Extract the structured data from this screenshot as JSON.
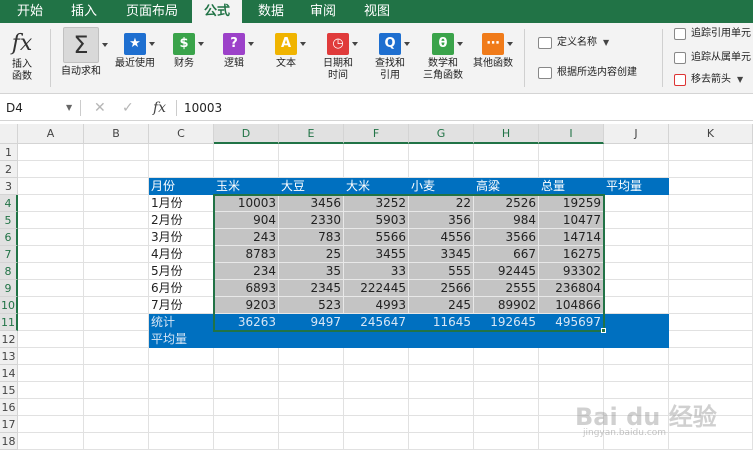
{
  "tabs": [
    "开始",
    "插入",
    "页面布局",
    "公式",
    "数据",
    "审阅",
    "视图"
  ],
  "ribbon": {
    "insert_function": {
      "line1": "插入",
      "line2": "函数"
    },
    "autosum": "自动求和",
    "recent": "最近使用",
    "financial": "财务",
    "logical": "逻辑",
    "text": "文本",
    "datetime": {
      "line1": "日期和",
      "line2": "时间"
    },
    "lookup": {
      "line1": "查找和",
      "line2": "引用"
    },
    "math": {
      "line1": "数学和",
      "line2": "三角函数"
    },
    "more": "其他函数",
    "define_name": "定义名称",
    "create_from_selection": "根据所选内容创建",
    "trace_precedents": "追踪引用单元",
    "trace_dependents": "追踪从属单元",
    "remove_arrows": "移去箭头",
    "icon_text": {
      "fx": "fx",
      "sum": "Σ",
      "recent": "★",
      "financial": "$",
      "logical": "?",
      "text": "A",
      "datetime": "◷",
      "lookup": "Q",
      "math": "θ",
      "more": "⋯"
    }
  },
  "formula_bar": {
    "name_box": "D4",
    "cancel": "✕",
    "enter": "✓",
    "fx": "fx",
    "value": "10003"
  },
  "columns": [
    "A",
    "B",
    "C",
    "D",
    "E",
    "F",
    "G",
    "H",
    "I",
    "J",
    "K"
  ],
  "rows": [
    "1",
    "2",
    "3",
    "4",
    "5",
    "6",
    "7",
    "8",
    "9",
    "10",
    "11",
    "12",
    "13",
    "14",
    "15",
    "16",
    "17",
    "18"
  ],
  "table": {
    "headers": [
      "月份",
      "玉米",
      "大豆",
      "大米",
      "小麦",
      "高粱",
      "总量",
      "平均量"
    ],
    "rows": [
      [
        "1月份",
        "10003",
        "3456",
        "3252",
        "22",
        "2526",
        "19259"
      ],
      [
        "2月份",
        "904",
        "2330",
        "5903",
        "356",
        "984",
        "10477"
      ],
      [
        "3月份",
        "243",
        "783",
        "5566",
        "4556",
        "3566",
        "14714"
      ],
      [
        "4月份",
        "8783",
        "25",
        "3455",
        "3345",
        "667",
        "16275"
      ],
      [
        "5月份",
        "234",
        "35",
        "33",
        "555",
        "92445",
        "93302"
      ],
      [
        "6月份",
        "6893",
        "2345",
        "222445",
        "2566",
        "2555",
        "236804"
      ],
      [
        "7月份",
        "9203",
        "523",
        "4993",
        "245",
        "89902",
        "104866"
      ]
    ],
    "total": [
      "统计",
      "36263",
      "9497",
      "245647",
      "11645",
      "192645",
      "495697"
    ],
    "average_label": "平均量"
  },
  "watermark": {
    "main": "Bai du 经验",
    "sub": "jingyan.baidu.com"
  },
  "colors": {
    "ribbon_green": "#217346",
    "header_blue": "#0070c0",
    "data_gray": "#c4c4c4"
  }
}
